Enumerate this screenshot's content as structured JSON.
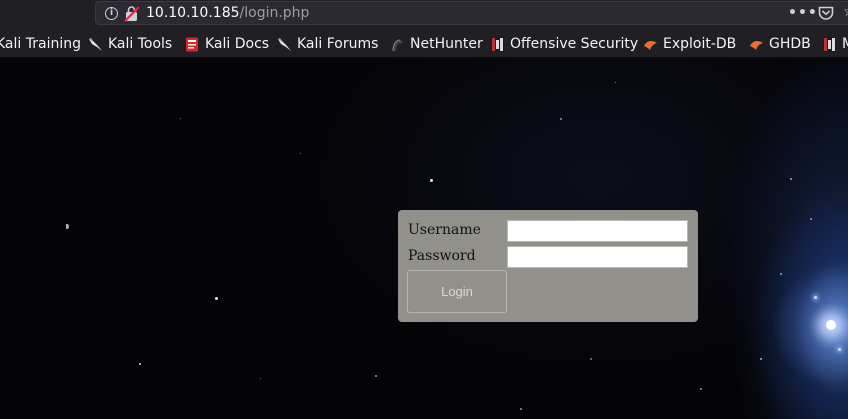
{
  "browser": {
    "url_host": "10.10.10.185",
    "url_path": "/login.php",
    "icons": [
      "info-icon",
      "insecure-lock-icon",
      "more-actions-icon",
      "pocket-icon",
      "bookmark-star-icon"
    ]
  },
  "bookmarks": [
    {
      "label": "Kali Training",
      "icon": "none"
    },
    {
      "label": "Kali Tools",
      "icon": "kali-dragon-icon"
    },
    {
      "label": "Kali Docs",
      "icon": "kali-docs-icon"
    },
    {
      "label": "Kali Forums",
      "icon": "kali-dragon-icon"
    },
    {
      "label": "NetHunter",
      "icon": "nethunter-icon"
    },
    {
      "label": "Offensive Security",
      "icon": "offsec-icon"
    },
    {
      "label": "Exploit-DB",
      "icon": "exploit-db-icon"
    },
    {
      "label": "GHDB",
      "icon": "ghdb-icon"
    },
    {
      "label": "M",
      "icon": "offsec-icon"
    }
  ],
  "login": {
    "username_label": "Username",
    "password_label": "Password",
    "username_value": "",
    "password_value": "",
    "button_label": "Login"
  },
  "colors": {
    "login_panel": "#91908a",
    "toolbar": "#1f1f24",
    "page_background": "#040407"
  }
}
